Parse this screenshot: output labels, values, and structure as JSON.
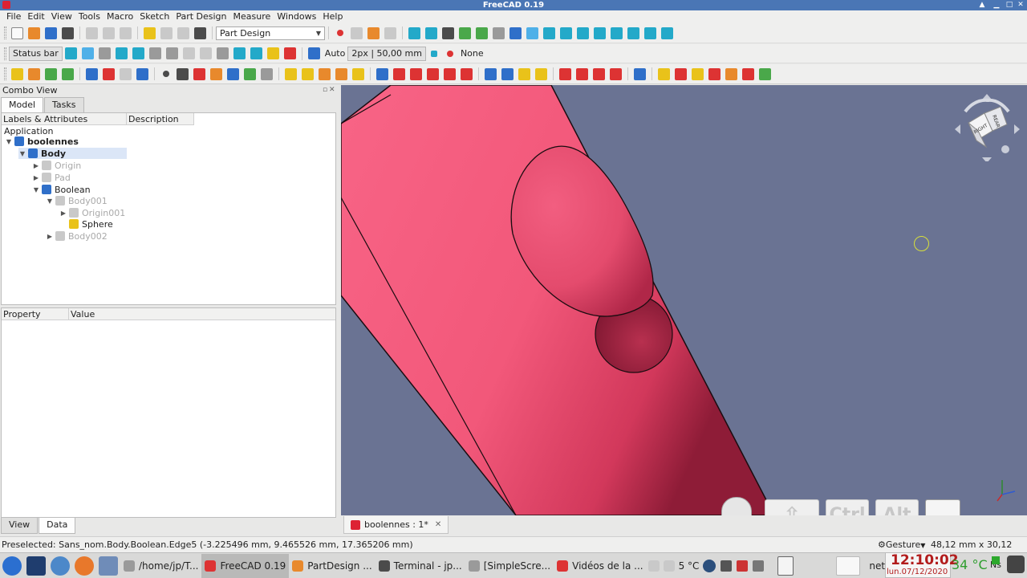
{
  "window": {
    "title": "FreeCAD 0.19"
  },
  "menu": [
    "File",
    "Edit",
    "View",
    "Tools",
    "Macro",
    "Sketch",
    "Part Design",
    "Measure",
    "Windows",
    "Help"
  ],
  "toolbar": {
    "workbench": "Part Design",
    "status_bar_label": "Status bar",
    "auto_label": "Auto",
    "line_width": "2px | 50,00 mm",
    "none_label": "None"
  },
  "combo_view": {
    "title": "Combo View",
    "tabs": [
      "Model",
      "Tasks"
    ],
    "tree_headers": [
      "Labels & Attributes",
      "Description"
    ],
    "application_label": "Application",
    "tree": [
      {
        "label": "boolennes",
        "icon": "document-icon"
      },
      {
        "label": "Body",
        "icon": "body-icon"
      },
      {
        "label": "Origin",
        "icon": "origin-icon"
      },
      {
        "label": "Pad",
        "icon": "pad-icon"
      },
      {
        "label": "Boolean",
        "icon": "boolean-icon"
      },
      {
        "label": "Body001",
        "icon": "body-icon"
      },
      {
        "label": "Origin001",
        "icon": "origin-icon"
      },
      {
        "label": "Sphere",
        "icon": "sphere-icon"
      },
      {
        "label": "Body002",
        "icon": "body-icon"
      }
    ],
    "property_headers": [
      "Property",
      "Value"
    ],
    "bottom_tabs": [
      "View",
      "Data"
    ]
  },
  "viewport": {
    "background_color": "#6a7393",
    "solid_color": "#f2587a",
    "navcube_faces": [
      "RIGHT",
      "REAR"
    ],
    "key_overlay": [
      "Ctrl",
      "Alt"
    ]
  },
  "document_tab": {
    "label": "boolennes : 1*"
  },
  "status": {
    "preselection": "Preselected: Sans_nom.Body.Boolean.Edge5 (-3.225496 mm, 9.465526 mm, 17.365206 mm)",
    "navigation": "Gesture",
    "dimensions": "48,12 mm x 30,12 mm"
  },
  "taskbar": {
    "items": [
      {
        "label": "/home/jp/T...",
        "icon": "folder-icon"
      },
      {
        "label": "FreeCAD 0.19",
        "icon": "freecad-icon"
      },
      {
        "label": "PartDesign ...",
        "icon": "firefox-icon"
      },
      {
        "label": "Terminal - jp...",
        "icon": "terminal-icon"
      },
      {
        "label": "[SimpleScre...",
        "icon": "record-icon"
      },
      {
        "label": "Vidéos de la ...",
        "icon": "firefox-icon"
      }
    ],
    "weather": "5 °C",
    "net_label": "net",
    "time": "12:10:02",
    "date": "lun.07/12/2020",
    "temperature": "34 °C",
    "sensor_label": "Ns"
  }
}
